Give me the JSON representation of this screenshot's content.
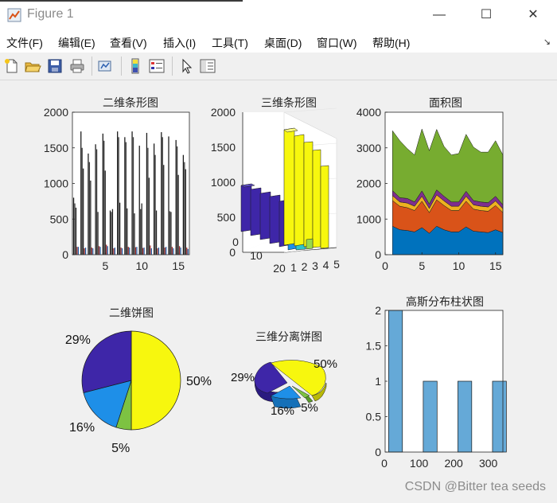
{
  "window": {
    "title": "Figure 1",
    "controls": {
      "minimize": "—",
      "maximize": "☐",
      "close": "✕"
    }
  },
  "menu": {
    "items": [
      "文件(F)",
      "编辑(E)",
      "查看(V)",
      "插入(I)",
      "工具(T)",
      "桌面(D)",
      "窗口(W)",
      "帮助(H)"
    ],
    "pin_glyph": "↘"
  },
  "toolbar": {
    "buttons": [
      "new-figure-icon",
      "open-file-icon",
      "save-icon",
      "print-icon",
      "link-plot-icon",
      "insert-colorbar-icon",
      "insert-legend-icon",
      "pointer-icon",
      "property-editor-icon"
    ]
  },
  "colors": {
    "yellow": "#f7f70e",
    "indigo": "#3e26a8",
    "blue": "#1e8fe8",
    "green": "#7dc242",
    "area_blue": "#0072bd",
    "area_orange": "#d95319",
    "area_gold": "#edb120",
    "area_purple": "#7e2f8e",
    "area_green": "#77ac30",
    "hist_bar": "#65a9d7"
  },
  "watermark": "CSDN @Bitter tea seeds",
  "chart_data": [
    {
      "type": "bar",
      "title": "二维条形图",
      "xticks": [
        "5",
        "10",
        "15"
      ],
      "yticks": [
        "0",
        "500",
        "1000",
        "1500",
        "2000"
      ],
      "ylim": [
        0,
        2000
      ],
      "xlim": [
        0.5,
        16.5
      ],
      "grid": false,
      "series": [
        {
          "name": "",
          "values": [
            800,
            1730,
            1420,
            1550,
            1700,
            620,
            1730,
            1650,
            1730,
            1530,
            1710,
            1560,
            1720,
            1660,
            1610,
            1400
          ]
        },
        {
          "name": "",
          "values": [
            720,
            1500,
            1300,
            1480,
            1600,
            600,
            1650,
            1580,
            1650,
            640,
            1500,
            1400,
            1650,
            610,
            1520,
            1300
          ]
        },
        {
          "name": "",
          "values": [
            660,
            1210,
            1040,
            600,
            1180,
            640,
            730,
            650,
            580,
            720,
            1080,
            620,
            1260,
            600,
            1120,
            1200
          ]
        },
        {
          "name": "",
          "values": [
            110,
            90,
            100,
            120,
            140,
            90,
            100,
            110,
            105,
            95,
            130,
            90,
            100,
            110,
            120,
            100
          ]
        },
        {
          "name": "",
          "values": [
            110,
            100,
            90,
            110,
            120,
            100,
            90,
            100,
            110,
            100,
            90,
            100,
            110,
            90,
            100,
            80
          ]
        }
      ]
    },
    {
      "type": "bar",
      "title": "三维条形图",
      "zticks": [
        "0",
        "500",
        "1000",
        "1500",
        "2000"
      ],
      "row_ticks": [
        "0",
        "10",
        "20"
      ],
      "col_ticks": [
        "1",
        "2",
        "3",
        "4",
        "5"
      ],
      "zlim": [
        0,
        2000
      ],
      "grid": true
    },
    {
      "type": "area",
      "title": "面积图",
      "x": [
        1,
        2,
        3,
        4,
        5,
        6,
        7,
        8,
        9,
        10,
        11,
        12,
        13,
        14,
        15,
        16
      ],
      "xticks": [
        "0",
        "5",
        "10",
        "15"
      ],
      "yticks": [
        "0",
        "1000",
        "2000",
        "3000",
        "4000"
      ],
      "xlim": [
        0,
        16
      ],
      "ylim": [
        0,
        4000
      ],
      "series": [
        {
          "name": "",
          "values": [
            800,
            700,
            680,
            640,
            760,
            600,
            800,
            700,
            640,
            640,
            780,
            660,
            640,
            620,
            700,
            620
          ]
        },
        {
          "name": "",
          "values": [
            720,
            660,
            640,
            600,
            740,
            580,
            740,
            680,
            600,
            600,
            720,
            620,
            600,
            600,
            680,
            560
          ]
        },
        {
          "name": "",
          "values": [
            140,
            120,
            130,
            120,
            140,
            120,
            140,
            130,
            120,
            120,
            140,
            120,
            120,
            120,
            130,
            110
          ]
        },
        {
          "name": "",
          "values": [
            140,
            120,
            130,
            120,
            150,
            120,
            140,
            130,
            120,
            120,
            140,
            120,
            120,
            120,
            130,
            110
          ]
        },
        {
          "name": "",
          "values": [
            1680,
            1600,
            1400,
            1320,
            1740,
            1500,
            1700,
            1400,
            1320,
            1360,
            1600,
            1500,
            1400,
            1420,
            1560,
            1400
          ]
        }
      ]
    },
    {
      "type": "pie",
      "title": "二维饼图",
      "slices": [
        {
          "label": "50%",
          "value": 50
        },
        {
          "label": "5%",
          "value": 5
        },
        {
          "label": "16%",
          "value": 16
        },
        {
          "label": "29%",
          "value": 29
        }
      ]
    },
    {
      "type": "pie",
      "title": "三维分离饼图",
      "slices": [
        {
          "label": "50%",
          "value": 50
        },
        {
          "label": "5%",
          "value": 5
        },
        {
          "label": "16%",
          "value": 16
        },
        {
          "label": "29%",
          "value": 29
        }
      ]
    },
    {
      "type": "bar",
      "title": "高斯分布柱状图",
      "categories": [
        0,
        100,
        200,
        300
      ],
      "values": [
        2,
        1,
        1,
        1
      ],
      "xticks": [
        "0",
        "100",
        "200",
        "300"
      ],
      "yticks": [
        "0",
        "0.5",
        "1",
        "1.5",
        "2"
      ],
      "ylim": [
        0,
        2
      ],
      "xlim": [
        -10,
        330
      ]
    }
  ]
}
